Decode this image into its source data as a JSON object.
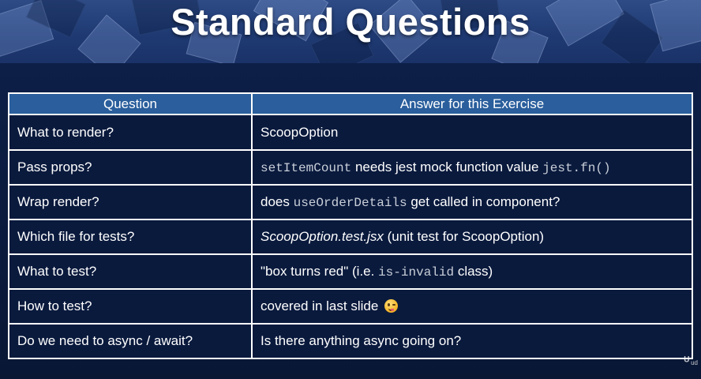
{
  "slide": {
    "title": "Standard Questions"
  },
  "table": {
    "headers": [
      "Question",
      "Answer for this Exercise"
    ],
    "rows": [
      {
        "question": "What to render?",
        "answer_plain": "ScoopOption"
      },
      {
        "question": "Pass props?",
        "answer_code_1": "setItemCount",
        "answer_text_1": " needs jest mock function value ",
        "answer_code_2": "jest.fn()"
      },
      {
        "question": "Wrap render?",
        "answer_text_1": "does ",
        "answer_code_1": "useOrderDetails",
        "answer_text_2": " get called in component?"
      },
      {
        "question": "Which file for tests?",
        "answer_italic": "ScoopOption.test.jsx",
        "answer_text_1": " (unit test for ScoopOption)"
      },
      {
        "question": "What to test?",
        "answer_text_1": "\"box turns red\" (i.e. ",
        "answer_code_1": "is-invalid",
        "answer_text_2": " class)"
      },
      {
        "question": "How to test?",
        "answer_text_1": "covered in last slide",
        "answer_icon": "winking-face-emoji"
      },
      {
        "question": "Do we need to async / await?",
        "answer_plain": "Is there anything async going on?"
      }
    ]
  },
  "watermark": {
    "glyph": "ᵁ",
    "text": "ud"
  },
  "colors": {
    "background": "#0a1a3d",
    "header_fill": "#2a5e9c",
    "grid": "#ffffff",
    "code_text": "#c9cfd9"
  }
}
